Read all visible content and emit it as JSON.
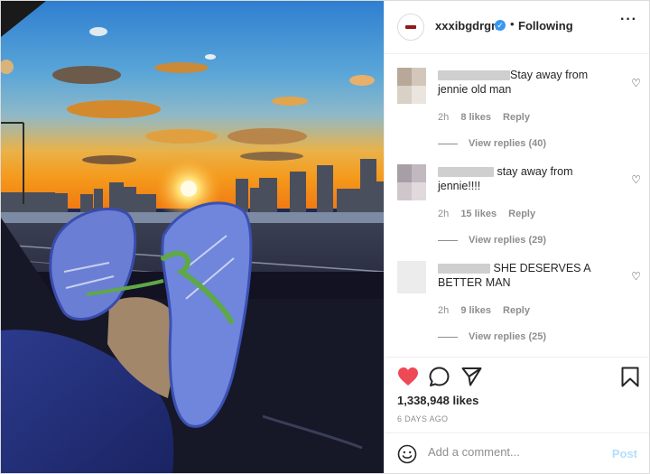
{
  "post": {
    "username": "xxxibgdrgn",
    "follow_status": "Following",
    "separator": "•",
    "verified_icon": "check-icon"
  },
  "comments": [
    {
      "text": "Stay away from jennie old man",
      "time": "2h",
      "likes": "8 likes",
      "reply": "Reply",
      "view_replies": "View replies (40)"
    },
    {
      "text": "stay away from jennie!!!!",
      "time": "2h",
      "likes": "15 likes",
      "reply": "Reply",
      "view_replies": "View replies (29)"
    },
    {
      "text": "SHE DESERVES A BETTER MAN",
      "time": "2h",
      "likes": "9 likes",
      "reply": "Reply",
      "view_replies": "View replies (25)"
    }
  ],
  "engagement": {
    "likes": "1,338,948 likes",
    "date": "6 DAYS AGO",
    "liked": true,
    "heart_color": "#ed4956"
  },
  "composer": {
    "placeholder": "Add a comment...",
    "post_label": "Post"
  }
}
